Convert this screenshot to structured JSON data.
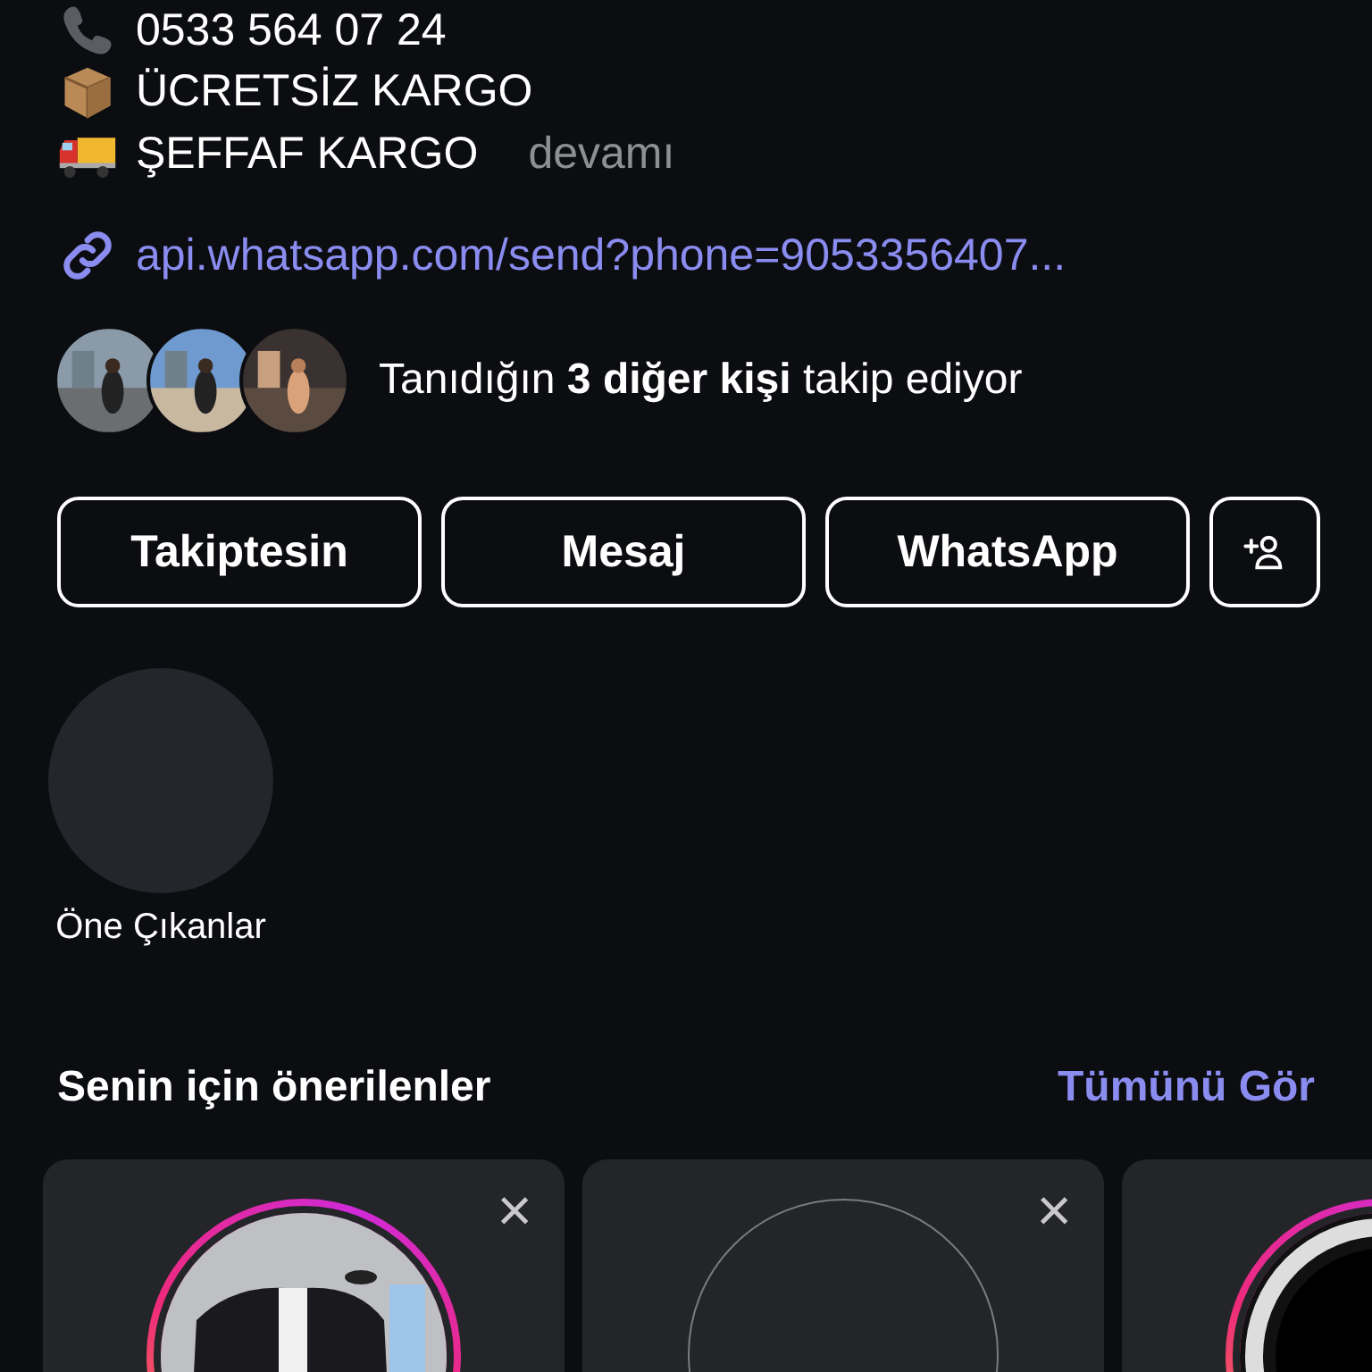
{
  "bio_lines": [
    {
      "kind": "phone",
      "text": "0533 564 07 24"
    },
    {
      "kind": "box",
      "text": "ÜCRETSİZ KARGO"
    },
    {
      "kind": "truck",
      "text": "ŞEFFAF KARGO",
      "more": "devamı"
    }
  ],
  "link": {
    "text": "api.whatsapp.com/send?phone=9053356407..."
  },
  "followed_by": {
    "text": "Tanıdığın **3 diğer kişi** takip ediyor"
  },
  "buttons": [
    "Takiptesin",
    "Mesaj",
    "WhatsApp"
  ],
  "highlights": [
    {
      "label": "Öne Çıkanlar"
    }
  ],
  "suggestions": {
    "title": "Senin için önerilenler",
    "see_all": "Tümünü Gör",
    "cards": [
      {
        "story_ring": true,
        "close": "×"
      },
      {
        "story_ring": false,
        "close": "×"
      },
      {
        "story_ring": true
      }
    ]
  }
}
